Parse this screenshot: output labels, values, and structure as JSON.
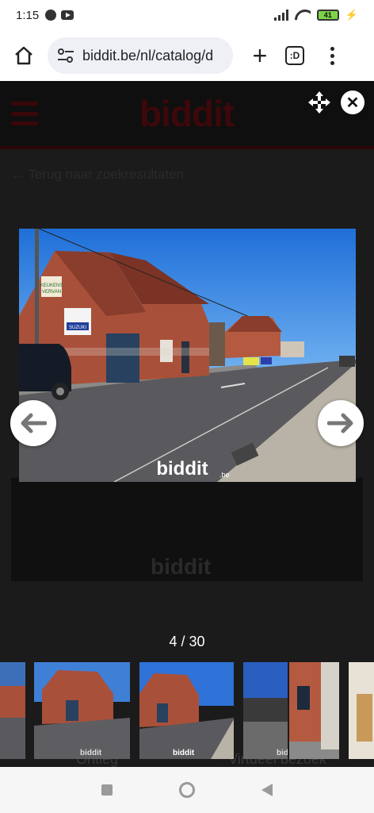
{
  "status_bar": {
    "time": "1:15",
    "battery": "41"
  },
  "browser": {
    "url": "biddit.be/nl/catalog/d",
    "tabs_label": ":D"
  },
  "site": {
    "logo": "biddit",
    "back_link": "Terug naar zoekresultaten",
    "bottom_labels": [
      "Ontleg",
      "Virtueel bezoek"
    ]
  },
  "lightbox": {
    "counter": "4 / 30",
    "watermark": "biddit",
    "watermark_suffix": ".be",
    "sign_keukens": [
      "KEUKENS",
      "VERVAN"
    ],
    "sign_suzuki": "SUZUKI"
  },
  "colors": {
    "brand": "#c8102e",
    "dim_overlay": "#1b1b1b"
  }
}
